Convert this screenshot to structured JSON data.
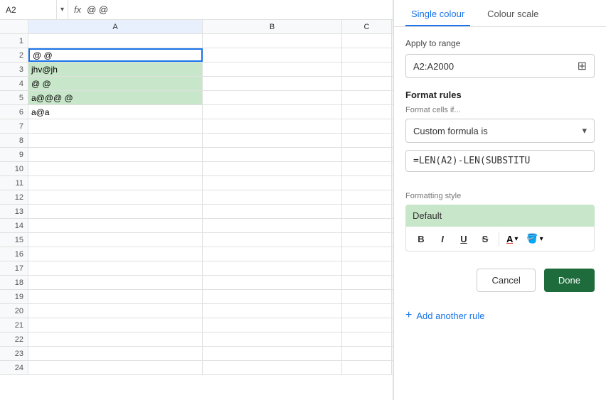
{
  "cell_ref": {
    "label": "A2",
    "dropdown_icon": "▾"
  },
  "formula_bar": {
    "fx_symbol": "fx",
    "value": "@ @"
  },
  "columns": {
    "a_label": "A",
    "b_label": "B",
    "c_label": "C"
  },
  "rows": [
    {
      "num": "1",
      "a": "",
      "highlighted": false
    },
    {
      "num": "2",
      "a": "@ @",
      "highlighted": false,
      "selected": true
    },
    {
      "num": "3",
      "a": "jhv@jh",
      "highlighted": true
    },
    {
      "num": "4",
      "a": "@ @",
      "highlighted": true
    },
    {
      "num": "5",
      "a": "a@@@ @",
      "highlighted": true
    },
    {
      "num": "6",
      "a": "a@a",
      "highlighted": false
    },
    {
      "num": "7",
      "a": "",
      "highlighted": false
    },
    {
      "num": "8",
      "a": "",
      "highlighted": false
    },
    {
      "num": "9",
      "a": "",
      "highlighted": false
    },
    {
      "num": "10",
      "a": "",
      "highlighted": false
    },
    {
      "num": "11",
      "a": "",
      "highlighted": false
    },
    {
      "num": "12",
      "a": "",
      "highlighted": false
    },
    {
      "num": "13",
      "a": "",
      "highlighted": false
    },
    {
      "num": "14",
      "a": "",
      "highlighted": false
    },
    {
      "num": "15",
      "a": "",
      "highlighted": false
    },
    {
      "num": "16",
      "a": "",
      "highlighted": false
    },
    {
      "num": "17",
      "a": "",
      "highlighted": false
    },
    {
      "num": "18",
      "a": "",
      "highlighted": false
    },
    {
      "num": "19",
      "a": "",
      "highlighted": false
    },
    {
      "num": "20",
      "a": "",
      "highlighted": false
    },
    {
      "num": "21",
      "a": "",
      "highlighted": false
    },
    {
      "num": "22",
      "a": "",
      "highlighted": false
    },
    {
      "num": "23",
      "a": "",
      "highlighted": false
    },
    {
      "num": "24",
      "a": "",
      "highlighted": false
    }
  ],
  "panel": {
    "tabs": [
      {
        "id": "single",
        "label": "Single colour",
        "active": true
      },
      {
        "id": "scale",
        "label": "Colour scale",
        "active": false
      }
    ],
    "apply_to_range_label": "Apply to range",
    "range_value": "A2:A2000",
    "grid_icon": "⊞",
    "format_rules_title": "Format rules",
    "format_cells_label": "Format cells if...",
    "dropdown_value": "Custom formula is",
    "dropdown_arrow": "▾",
    "formula_value": "=LEN(A2)-LEN(SUBSTITU",
    "formatting_style_label": "Formatting style",
    "style_preview_text": "Default",
    "toolbar": {
      "bold": "B",
      "italic": "I",
      "underline": "U",
      "strikethrough": "S",
      "font_color": "A",
      "fill_color": "🪣"
    },
    "cancel_label": "Cancel",
    "done_label": "Done",
    "add_rule_label": "Add another rule",
    "plus": "+"
  }
}
